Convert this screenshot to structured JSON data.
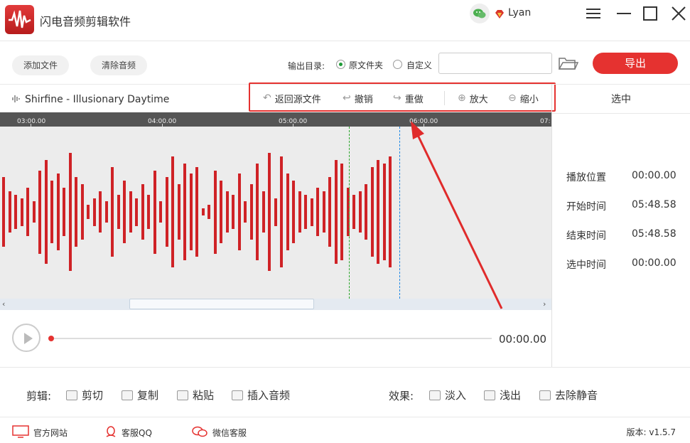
{
  "window": {
    "title": "闪电音频剪辑软件",
    "user_name": "Lyan"
  },
  "toolbar": {
    "add_file_label": "添加文件",
    "clear_audio_label": "清除音频",
    "output_dir_label": "输出目录:",
    "radio_source_folder_label": "原文件夹",
    "radio_custom_label": "自定义",
    "radio_selected": "原文件夹",
    "output_path_value": "",
    "export_label": "导出"
  },
  "track": {
    "name": "Shirfine - Illusionary Daytime"
  },
  "edit_actions": {
    "back_to_source": "返回源文件",
    "undo": "撤销",
    "redo": "重做",
    "zoom_in": "放大",
    "zoom_out": "缩小"
  },
  "ruler": {
    "labels": [
      "03:00.00",
      "04:00.00",
      "05:00.00",
      "06:00.00",
      "07:"
    ]
  },
  "selection_panel": {
    "title": "选中",
    "rows": [
      {
        "label": "播放位置",
        "value": "00:00.00"
      },
      {
        "label": "开始时间",
        "value": "05:48.58"
      },
      {
        "label": "结束时间",
        "value": "05:48.58"
      },
      {
        "label": "选中时间",
        "value": "00:00.00"
      }
    ]
  },
  "player": {
    "time": "00:00.00",
    "progress": 0
  },
  "edit_tools": {
    "label": "剪辑:",
    "cut": "剪切",
    "copy": "复制",
    "paste": "粘贴",
    "insert_audio": "插入音频"
  },
  "effect_tools": {
    "label": "效果:",
    "fade_in": "淡入",
    "fade_out": "浅出",
    "remove_silence": "去除静音"
  },
  "footer": {
    "website": "官方网站",
    "qq_support": "客服QQ",
    "wechat_support": "微信客服",
    "version": "版本: v1.5.7"
  },
  "colors": {
    "accent": "#e53230",
    "waveform": "#cf2226",
    "start_marker": "#2ba52b",
    "cursor_marker": "#1e88e5",
    "ruler_bg": "#555555",
    "wave_bg": "#ececec"
  },
  "icons": [
    "app-logo-icon",
    "wechat-icon",
    "vip-diamond-icon",
    "menu-icon",
    "minimize-icon",
    "maximize-icon",
    "close-icon",
    "folder-icon",
    "waveform-icon",
    "back-icon",
    "undo-icon",
    "redo-icon",
    "zoom-in-icon",
    "zoom-out-icon",
    "play-icon",
    "cut-icon",
    "copy-icon",
    "paste-icon",
    "insert-icon",
    "fade-in-icon",
    "fade-out-icon",
    "mute-icon",
    "monitor-icon",
    "qq-icon"
  ],
  "waveform_amplitudes": [
    0.5,
    0.3,
    0.25,
    0.2,
    0.35,
    0.15,
    0.6,
    0.75,
    0.45,
    0.55,
    0.35,
    0.85,
    0.5,
    0.4,
    0.1,
    0.2,
    0.3,
    0.15,
    0.65,
    0.25,
    0.45,
    0.3,
    0.2,
    0.4,
    0.25,
    0.6,
    0.15,
    0.5,
    0.8,
    0.4,
    0.7,
    0.55,
    0.65,
    0.05,
    0.1,
    0.6,
    0.45,
    0.3,
    0.25,
    0.55,
    0.15,
    0.4,
    0.7,
    0.3,
    0.85,
    0.2,
    0.8,
    0.55,
    0.45,
    0.3,
    0.25,
    0.2,
    0.35,
    0.3,
    0.5,
    0.75,
    0.7,
    0.35,
    0.25,
    0.3,
    0.4,
    0.65,
    0.75,
    0.7,
    0.8
  ]
}
